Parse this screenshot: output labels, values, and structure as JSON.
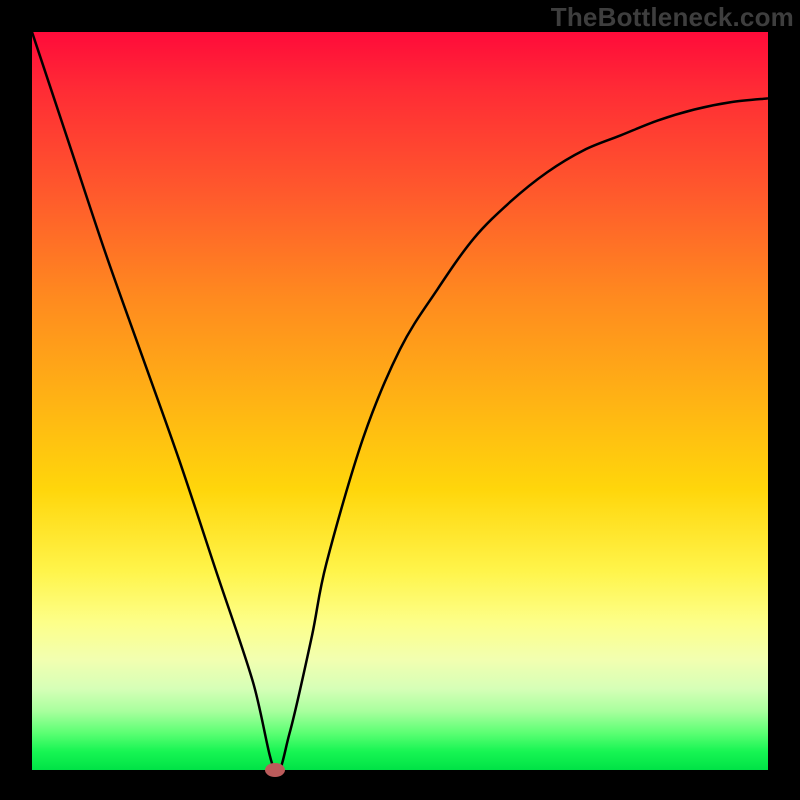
{
  "attribution": "TheBottleneck.com",
  "chart_data": {
    "type": "line",
    "title": "",
    "xlabel": "",
    "ylabel": "",
    "xlim": [
      0,
      100
    ],
    "ylim": [
      0,
      100
    ],
    "grid": false,
    "legend": false,
    "background": {
      "kind": "vertical-gradient",
      "stops": [
        {
          "pos": 0,
          "color": "#ff0b3a"
        },
        {
          "pos": 50,
          "color": "#ffb314"
        },
        {
          "pos": 80,
          "color": "#fdff89"
        },
        {
          "pos": 100,
          "color": "#00e246"
        }
      ]
    },
    "series": [
      {
        "name": "bottleneck-curve",
        "color": "#000000",
        "x": [
          0,
          5,
          10,
          15,
          20,
          25,
          30,
          33,
          35,
          38,
          40,
          45,
          50,
          55,
          60,
          65,
          70,
          75,
          80,
          85,
          90,
          95,
          100
        ],
        "y": [
          100,
          85,
          70,
          56,
          42,
          27,
          12,
          0,
          5,
          18,
          28,
          45,
          57,
          65,
          72,
          77,
          81,
          84,
          86,
          88,
          89.5,
          90.5,
          91
        ]
      }
    ],
    "annotations": [
      {
        "name": "vertex-marker",
        "x": 33,
        "y": 0,
        "color": "#bb5b5b",
        "shape": "ellipse"
      }
    ]
  }
}
